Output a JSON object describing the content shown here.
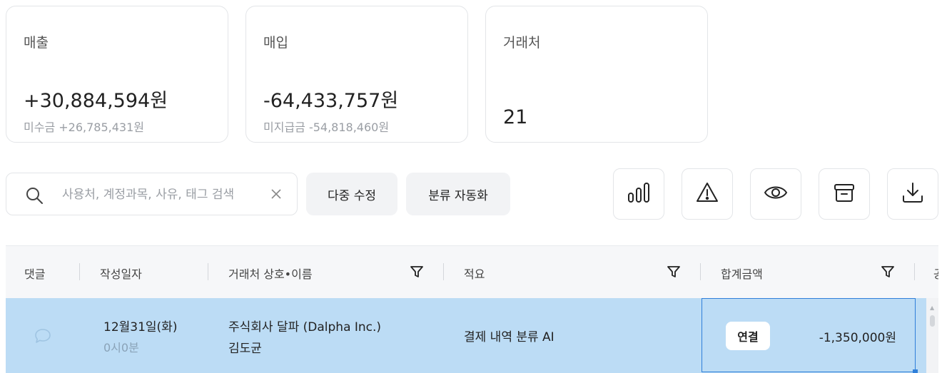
{
  "summary": {
    "sales": {
      "label": "매출",
      "value": "+30,884,594원",
      "sub": "미수금 +26,785,431원"
    },
    "purchase": {
      "label": "매입",
      "value": "-64,433,757원",
      "sub": "미지급금 -54,818,460원"
    },
    "partners": {
      "label": "거래처",
      "value": "21"
    }
  },
  "toolbar": {
    "search_placeholder": "사용처, 계정과목, 사유, 태그 검색",
    "bulk_edit_label": "다중 수정",
    "auto_classify_label": "분류 자동화",
    "icons": [
      "bar-chart-icon",
      "warning-icon",
      "eye-icon",
      "archive-icon",
      "download-icon"
    ]
  },
  "table": {
    "columns": [
      "댓글",
      "작성일자",
      "거래처 상호•이름",
      "적요",
      "합계금액",
      "공"
    ],
    "rows": [
      {
        "date": "12월31일(화)",
        "time": "0시0분",
        "partner_name": "주식회사 달파 (Dalpha Inc.)",
        "partner_person": "김도균",
        "description": "결제 내역 분류 AI",
        "link_label": "연결",
        "amount": "-1,350,000원"
      }
    ]
  },
  "colors": {
    "selected_row": "#bcdcf5",
    "selection_border": "#2f7fd9"
  }
}
